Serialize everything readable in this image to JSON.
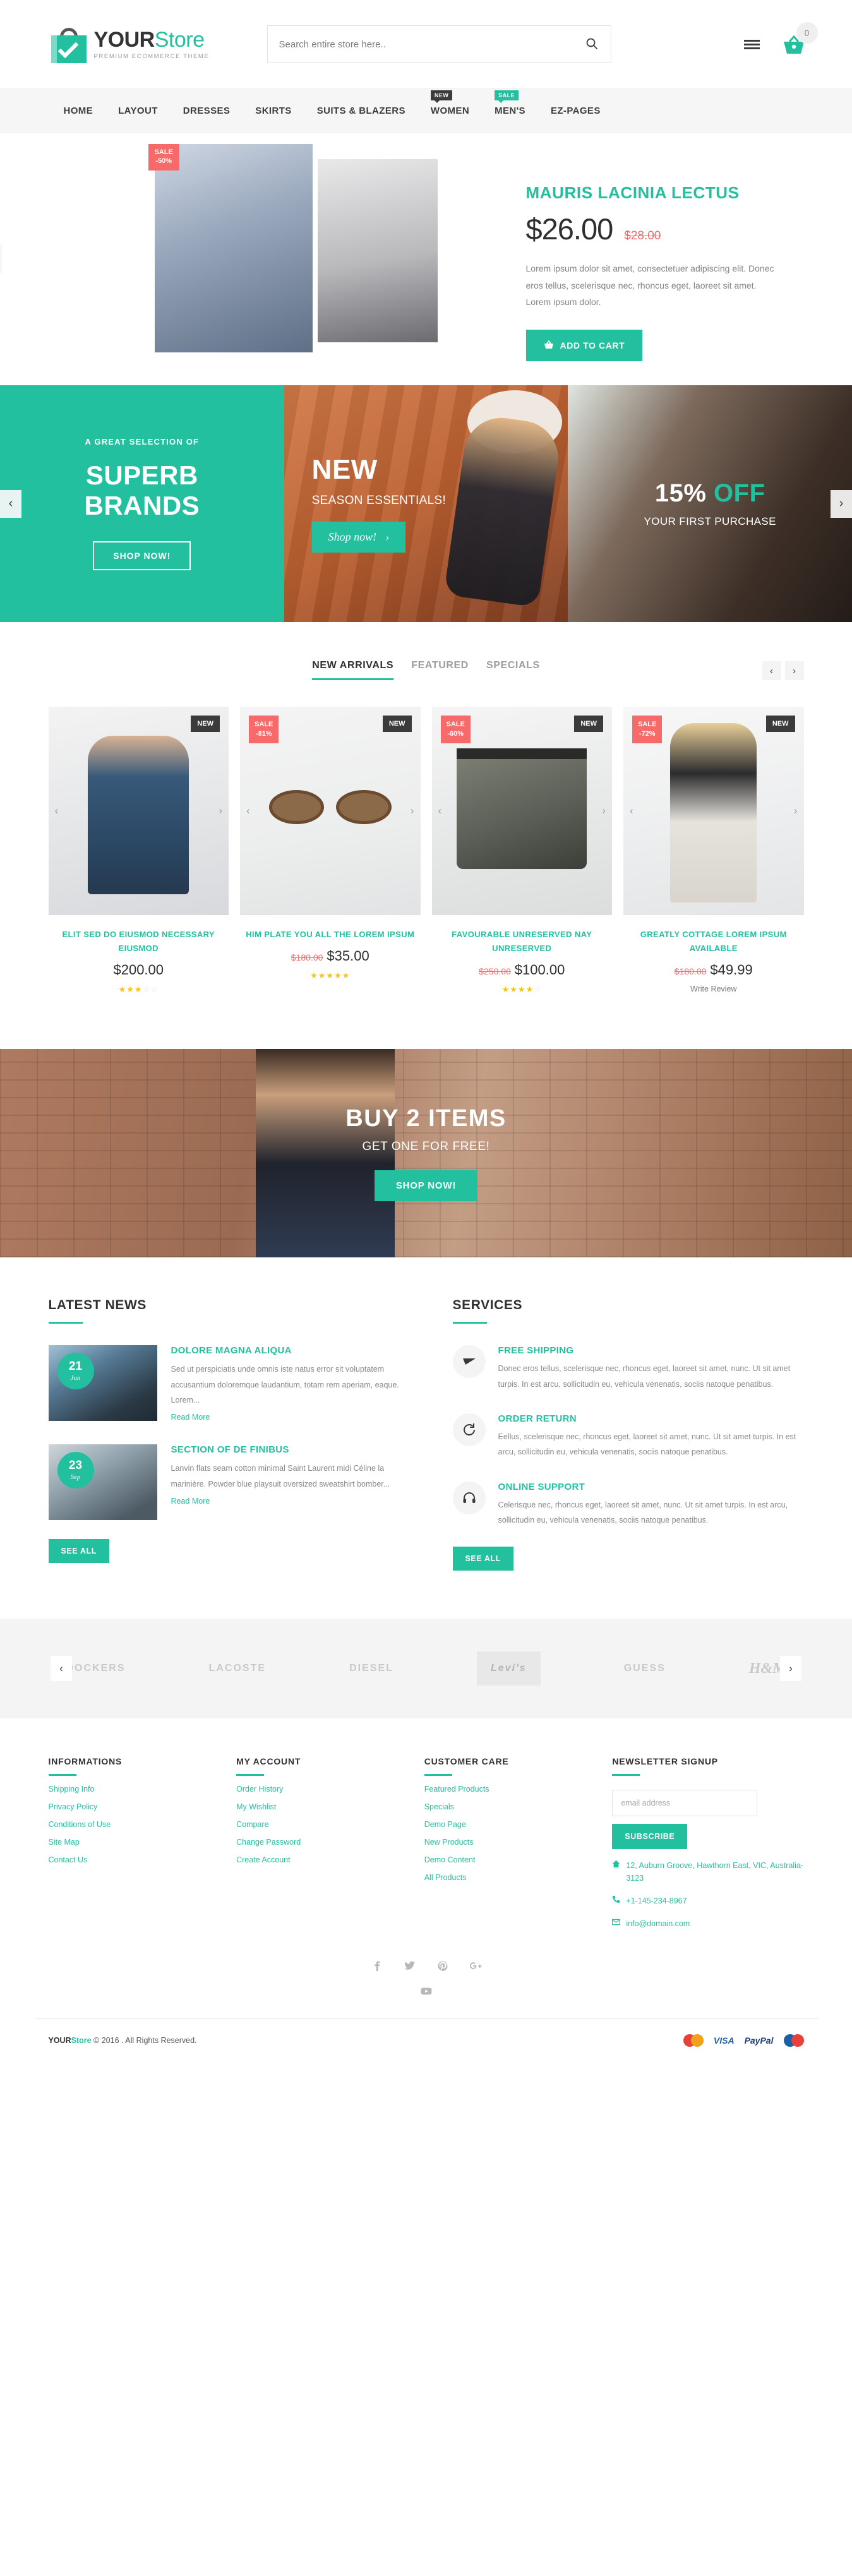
{
  "header": {
    "logo_main": "YOUR",
    "logo_accent": "Store",
    "logo_tagline": "PREMIUM ECOMMERCE THEME",
    "search_placeholder": "Search entire store here..",
    "search_value": "",
    "cart_count": "0"
  },
  "nav": {
    "items": [
      {
        "label": "HOME",
        "badge": "",
        "badge_type": ""
      },
      {
        "label": "LAYOUT",
        "badge": "",
        "badge_type": ""
      },
      {
        "label": "DRESSES",
        "badge": "",
        "badge_type": ""
      },
      {
        "label": "SKIRTS",
        "badge": "",
        "badge_type": ""
      },
      {
        "label": "SUITS & BLAZERS",
        "badge": "",
        "badge_type": ""
      },
      {
        "label": "WOMEN",
        "badge": "NEW",
        "badge_type": "dark"
      },
      {
        "label": "MEN'S",
        "badge": "SALE",
        "badge_type": "teal"
      },
      {
        "label": "EZ-PAGES",
        "badge": "",
        "badge_type": ""
      }
    ]
  },
  "hero": {
    "sale_badge_line1": "SALE",
    "sale_badge_line2": "-50%",
    "title": "MAURIS LACINIA LECTUS",
    "price": "$26.00",
    "old_price": "$28.00",
    "description": "Lorem ipsum dolor sit amet, consectetuer adipiscing elit. Donec eros tellus, scelerisque nec, rhoncus eget, laoreet sit amet. Lorem ipsum dolor.",
    "add_to_cart": "ADD TO CART",
    "prev": "‹",
    "next": "›"
  },
  "promos": {
    "prev": "‹",
    "next": "›",
    "items": [
      {
        "small": "A GREAT SELECTION OF",
        "big_line1": "SUPERB",
        "big_line2": "BRANDS",
        "button": "SHOP NOW!"
      },
      {
        "big": "NEW",
        "sub": "SEASON ESSENTIALS!",
        "button": "Shop now!",
        "button_arrow": "›"
      },
      {
        "pct": "15%",
        "off": "OFF",
        "sub": "YOUR FIRST PURCHASE"
      }
    ]
  },
  "products": {
    "tabs": [
      {
        "label": "NEW ARRIVALS",
        "active": true
      },
      {
        "label": "FEATURED",
        "active": false
      },
      {
        "label": "SPECIALS",
        "active": false
      }
    ],
    "prev": "‹",
    "next": "›",
    "items": [
      {
        "title": "ELIT SED DO EIUSMOD NECESSARY EIUSMOD",
        "price": "$200.00",
        "old_price": "",
        "sale_badge": "",
        "sale_pct": "",
        "new_badge": "NEW",
        "rating": 3,
        "review_link": ""
      },
      {
        "title": "HIM PLATE YOU ALL THE LOREM IPSUM",
        "price": "$35.00",
        "old_price": "$180.00",
        "sale_badge": "SALE",
        "sale_pct": "-81%",
        "new_badge": "NEW",
        "rating": 5,
        "review_link": ""
      },
      {
        "title": "FAVOURABLE UNRESERVED NAY UNRESERVED",
        "price": "$100.00",
        "old_price": "$250.00",
        "sale_badge": "SALE",
        "sale_pct": "-60%",
        "new_badge": "NEW",
        "rating": 4,
        "review_link": ""
      },
      {
        "title": "GREATLY COTTAGE LOREM IPSUM AVAILABLE",
        "price": "$49.99",
        "old_price": "$180.00",
        "sale_badge": "SALE",
        "sale_pct": "-72%",
        "new_badge": "NEW",
        "rating": 0,
        "review_link": "Write Review"
      }
    ]
  },
  "big_banner": {
    "title": "BUY 2 ITEMS",
    "subtitle": "GET ONE FOR FREE!",
    "button": "SHOP NOW!"
  },
  "news": {
    "title": "LATEST NEWS",
    "see_all": "SEE ALL",
    "items": [
      {
        "day": "21",
        "month": "Jun",
        "title": "DOLORE MAGNA ALIQUA",
        "text": "Sed ut perspiciatis unde omnis iste natus error sit voluptatem accusantium doloremque laudantium, totam rem aperiam, eaque. Lorem...",
        "read_more": "Read More"
      },
      {
        "day": "23",
        "month": "Sep",
        "title": "SECTION OF DE FINIBUS",
        "text": "Lanvin flats seam cotton minimal Saint Laurent midi Céline la marinière. Powder blue playsuit oversized sweatshirt bomber...",
        "read_more": "Read More"
      }
    ]
  },
  "services": {
    "title": "SERVICES",
    "see_all": "SEE ALL",
    "items": [
      {
        "icon": "paper-plane-icon",
        "title": "FREE SHIPPING",
        "text": "Donec eros tellus, scelerisque nec, rhoncus eget, laoreet sit amet, nunc. Ut sit amet turpis. In est arcu, sollicitudin eu, vehicula venenatis, sociis natoque penatibus."
      },
      {
        "icon": "refresh-icon",
        "title": "ORDER RETURN",
        "text": "Eellus, scelerisque nec, rhoncus eget, laoreet sit amet, nunc. Ut sit amet turpis. In est arcu, sollicitudin eu, vehicula venenatis, sociis natoque penatibus."
      },
      {
        "icon": "headset-icon",
        "title": "ONLINE SUPPORT",
        "text": "Celerisque nec, rhoncus eget, laoreet sit amet, nunc. Ut sit amet turpis. In est arcu, sollicitudin eu, vehicula venenatis, sociis natoque penatibus."
      }
    ]
  },
  "brands": {
    "prev": "‹",
    "next": "›",
    "items": [
      {
        "name": "DOCKERS"
      },
      {
        "name": "LACOSTE"
      },
      {
        "name": "DIESEL"
      },
      {
        "name": "Levi's"
      },
      {
        "name": "GUESS"
      },
      {
        "name": "H&M"
      }
    ]
  },
  "footer": {
    "columns": [
      {
        "title": "INFORMATIONS",
        "links": [
          "Shipping Info",
          "Privacy Policy",
          "Conditions of Use",
          "Site Map",
          "Contact Us"
        ]
      },
      {
        "title": "MY ACCOUNT",
        "links": [
          "Order History",
          "My Wishlist",
          "Compare",
          "Change Password",
          "Create Account"
        ]
      },
      {
        "title": "CUSTOMER CARE",
        "links": [
          "Featured Products",
          "Specials",
          "Demo Page",
          "New Products",
          "Demo Content",
          "All Products"
        ]
      }
    ],
    "newsletter": {
      "title": "NEWSLETTER SIGNUP",
      "placeholder": "email address",
      "value": "",
      "button": "SUBSCRIBE"
    },
    "contact": {
      "address": "12, Auburn Groove, Hawthorn East, VIC, Australia-3123",
      "phone": "+1-145-234-8967",
      "email": "info@domain.com"
    },
    "socials": [
      "facebook-icon",
      "twitter-icon",
      "pinterest-icon",
      "google-plus-icon",
      "youtube-icon"
    ],
    "copyright_brand_main": "YOUR",
    "copyright_brand_accent": "Store",
    "copyright_text": " © 2016 . All Rights Reserved.",
    "payments": [
      "MasterCard",
      "VISA",
      "PayPal",
      "Maestro"
    ]
  },
  "colors": {
    "accent": "#23c0a0",
    "sale": "#f86a6a",
    "dark": "#3b3b3b",
    "star": "#f5c518"
  }
}
